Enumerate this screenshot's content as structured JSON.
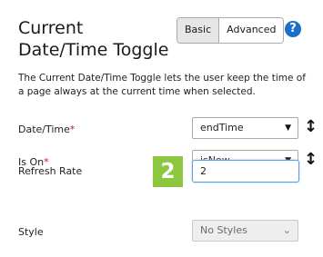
{
  "header": {
    "title": "Current Date/Time Toggle",
    "modes": [
      "Basic",
      "Advanced"
    ],
    "help_glyph": "?"
  },
  "description": "The Current Date/Time Toggle lets the user keep the time of a page always at the current time when selected.",
  "fields": {
    "datetime": {
      "label": "Date/Time",
      "required_mark": "*",
      "value": "endTime"
    },
    "is_on": {
      "label": "Is On",
      "required_mark": "*",
      "value": "isNow"
    },
    "refresh_rate": {
      "label": "Refresh Rate",
      "value": "2"
    },
    "style": {
      "label": "Style",
      "value": "No Styles"
    }
  },
  "badge": "2",
  "icons": [
    "help-icon",
    "sort-icon",
    "dropdown-caret-icon"
  ],
  "colors": {
    "accent_blue": "#1c6fc7",
    "badge_green": "#8dc63f",
    "required_red": "#c11a1a"
  }
}
